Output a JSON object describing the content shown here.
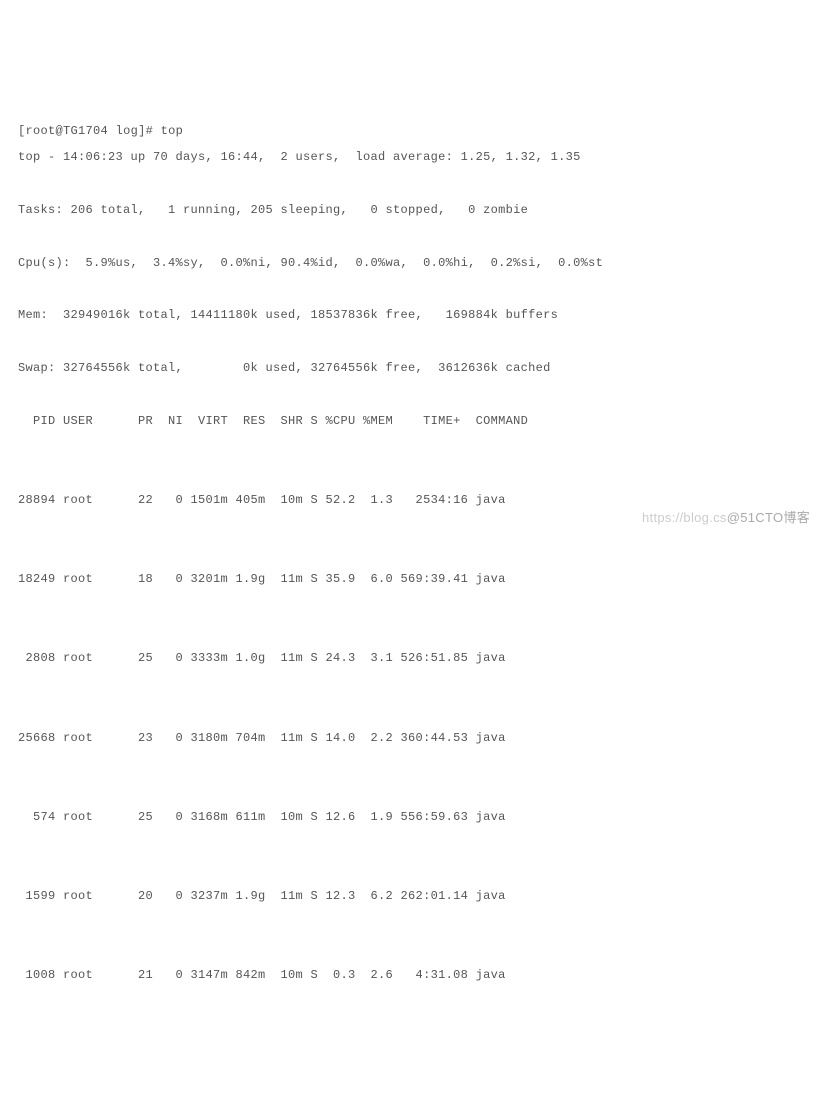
{
  "prompt": {
    "user": "root",
    "host": "TG1704",
    "path": "log",
    "cmd": "top"
  },
  "summary": {
    "line1": "top - 14:06:23 up 70 days, 16:44,  2 users,  load average: 1.25, 1.32, 1.35",
    "line2": "Tasks: 206 total,   1 running, 205 sleeping,   0 stopped,   0 zombie",
    "line3": "Cpu(s):  5.9%us,  3.4%sy,  0.0%ni, 90.4%id,  0.0%wa,  0.0%hi,  0.2%si,  0.0%st",
    "line4": "Mem:  32949016k total, 14411180k used, 18537836k free,   169884k buffers",
    "line5": "Swap: 32764556k total,        0k used, 32764556k free,  3612636k cached"
  },
  "header": "  PID USER      PR  NI  VIRT  RES  SHR S %CPU %MEM    TIME+  COMMAND",
  "rows": [
    "28894 root      22   0 1501m 405m  10m S 52.2  1.3   2534:16 java",
    "18249 root      18   0 3201m 1.9g  11m S 35.9  6.0 569:39.41 java",
    " 2808 root      25   0 3333m 1.0g  11m S 24.3  3.1 526:51.85 java",
    "25668 root      23   0 3180m 704m  11m S 14.0  2.2 360:44.53 java",
    "  574 root      25   0 3168m 611m  10m S 12.6  1.9 556:59.63 java",
    " 1599 root      20   0 3237m 1.9g  11m S 12.3  6.2 262:01.14 java",
    " 1008 root      21   0 3147m 842m  10m S  0.3  2.6   4:31.08 java"
  ],
  "watermark": {
    "a": "https://blog.cs",
    "b": "@51CTO博客"
  }
}
